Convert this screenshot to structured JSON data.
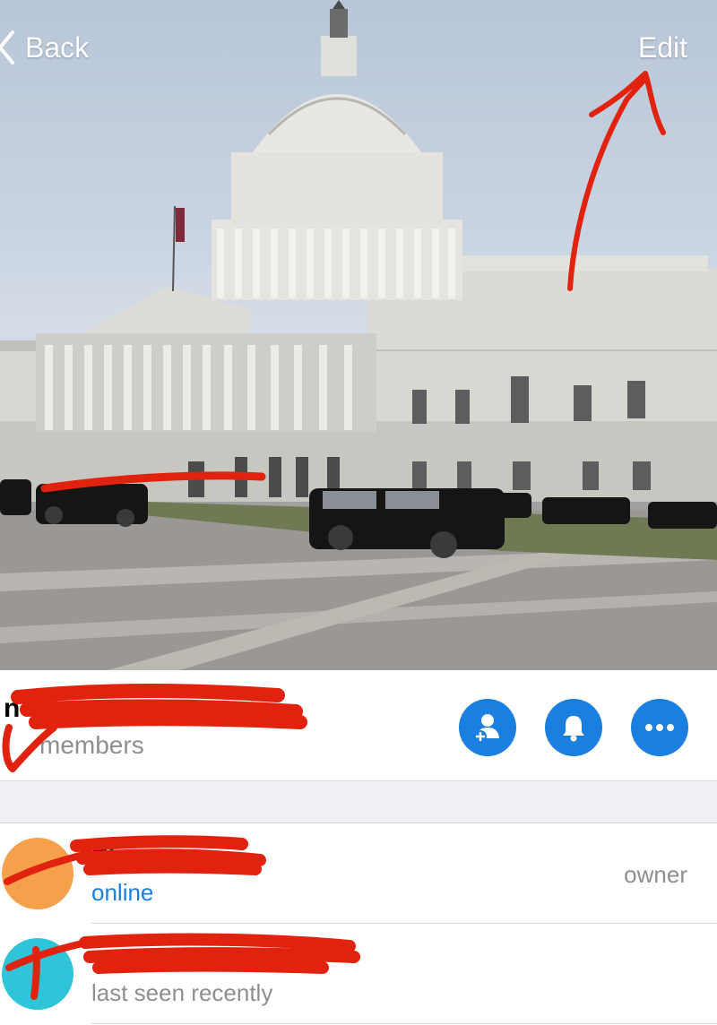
{
  "nav": {
    "back_label": "Back",
    "edit_label": "Edit"
  },
  "group": {
    "title": "n",
    "members_text": "members"
  },
  "actions": [
    {
      "name": "add-member-button",
      "icon": "add-user-icon"
    },
    {
      "name": "notifications-button",
      "icon": "bell-icon"
    },
    {
      "name": "more-button",
      "icon": "more-icon"
    }
  ],
  "members": [
    {
      "name": "El",
      "status": "online",
      "role": "owner",
      "avatar_color": "#f5a04a",
      "status_color": "#1a7fe0"
    },
    {
      "name": "",
      "status": "last seen recently",
      "role": "",
      "avatar_color": "#2fc4d8",
      "status_color": "#8e8e93"
    }
  ],
  "colors": {
    "accent": "#1a7fe0",
    "redaction": "#e0220e"
  }
}
